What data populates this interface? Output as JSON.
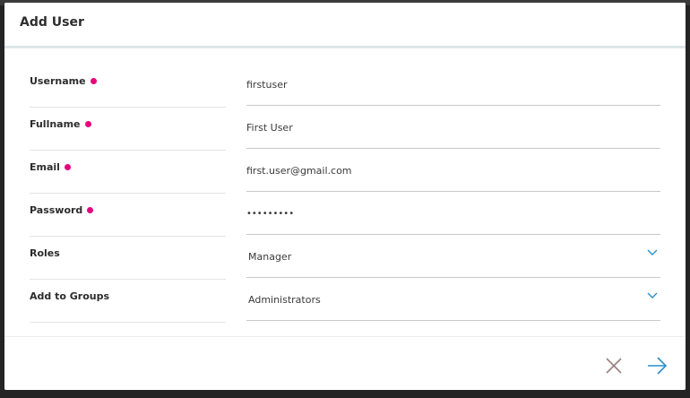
{
  "dialog": {
    "title": "Add User"
  },
  "form": {
    "fields": [
      {
        "label": "Username",
        "required": true,
        "value": "firstuser",
        "type": "text"
      },
      {
        "label": "Fullname",
        "required": true,
        "value": "First User",
        "type": "text"
      },
      {
        "label": "Email",
        "required": true,
        "value": "first.user@gmail.com",
        "type": "text"
      },
      {
        "label": "Password",
        "required": true,
        "value": "•••••••••",
        "type": "password"
      },
      {
        "label": "Roles",
        "required": false,
        "value": "Manager",
        "type": "select"
      },
      {
        "label": "Add to Groups",
        "required": false,
        "value": "Administrators",
        "type": "select"
      }
    ]
  },
  "footer": {
    "cancel_icon": "close-icon",
    "submit_icon": "arrow-right-icon"
  },
  "colors": {
    "required": "#e6007e",
    "accent": "#2a8fc7",
    "cancel": "#9a7f7f"
  }
}
